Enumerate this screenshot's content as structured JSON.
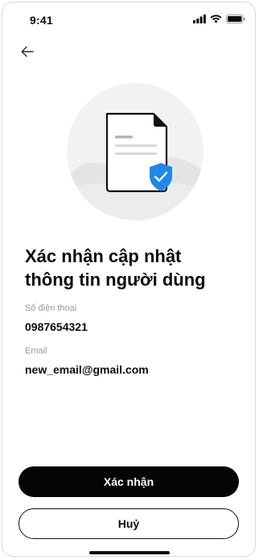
{
  "status_bar": {
    "time": "9:41",
    "icons": [
      "signal-icon",
      "wifi-icon",
      "battery-icon"
    ]
  },
  "nav": {
    "back_icon": "arrow-left-icon"
  },
  "illustration": {
    "icon": "document-verified-icon",
    "accent_color": "#1e88e5"
  },
  "title": {
    "line1": "Xác nhận cập nhật",
    "line2": "thông tin người dùng"
  },
  "fields": [
    {
      "label": "Số điện thoại",
      "value": "0987654321"
    },
    {
      "label": "Email",
      "value": "new_email@gmail.com"
    }
  ],
  "actions": {
    "confirm_label": "Xác nhận",
    "cancel_label": "Huỷ"
  },
  "colors": {
    "primary_button": "#050505",
    "label_gray": "#9a9a9a"
  }
}
